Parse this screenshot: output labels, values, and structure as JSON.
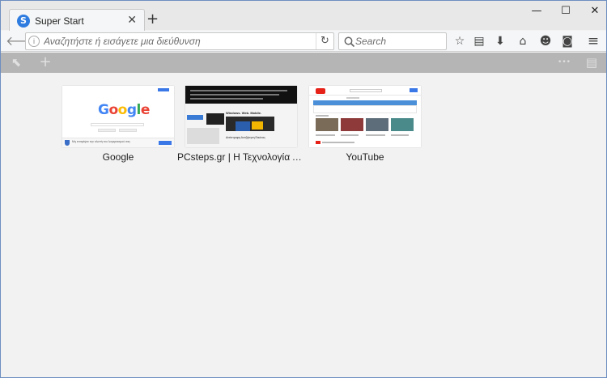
{
  "window": {
    "controls": {
      "minimize": "—",
      "maximize": "☐",
      "close": "✕"
    }
  },
  "tab": {
    "favicon_letter": "S",
    "title": "Super Start",
    "close": "✕",
    "new_tab": "+"
  },
  "navbar": {
    "back": "🡐",
    "url_placeholder": "Αναζητήστε ή εισάγετε μια διεύθυνση",
    "info": "i",
    "reload": "↻",
    "search_placeholder": "Search",
    "toolbar_icons": {
      "bookmark_star": "☆",
      "reading_list": "▤",
      "downloads": "⬇",
      "home": "⌂",
      "emoji": "☻",
      "pocket": "◙",
      "menu": "≡"
    }
  },
  "superstart_toolbar": {
    "pointer": "⬉",
    "add": "+",
    "more": "•••",
    "sidebar": "▤"
  },
  "sites": [
    {
      "title": "Google",
      "logo_letters": [
        "G",
        "o",
        "o",
        "g",
        "l",
        "e"
      ],
      "logo_colors": [
        "#4285f4",
        "#ea4335",
        "#fbbc05",
        "#4285f4",
        "#34a853",
        "#ea4335"
      ],
      "footer_text": "Μη επιτρέψτε την κλοπή του λογαριασμού σας"
    },
    {
      "title": "PCsteps.gr | Η Τεχνολογία Απλά",
      "headline": "Windows. Web. Mobile.",
      "caption": "Αντίστροφη Αναζήτηση Εικόνας"
    },
    {
      "title": "YouTube"
    }
  ],
  "colors": {
    "accent": "#2e7ce0",
    "superstart_bar": "#b5b5b5",
    "youtube_red": "#e62117"
  }
}
